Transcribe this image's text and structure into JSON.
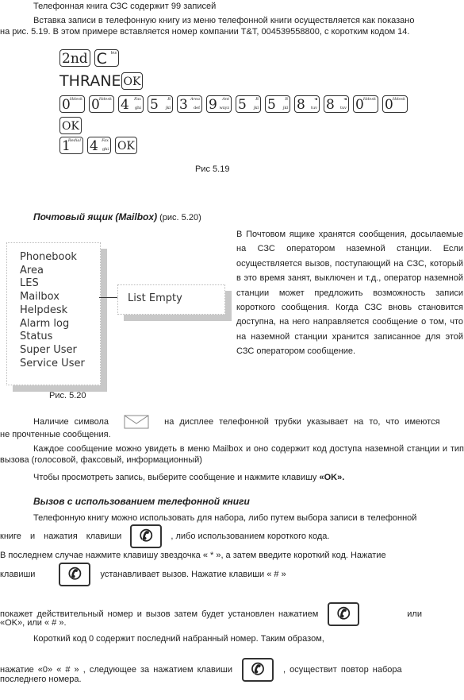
{
  "p1": "Телефонная книга СЗС содержит 99 записей",
  "p2a": "Вставка записи в телефонную книгу из меню телефонной книги осуществляется как показано",
  "p2b": "на рис. 5.19. В этом примере вставляется номер компании T&T, 004539558800, с коротким кодом 14.",
  "keys": {
    "k2nd": "2nd",
    "kC": "C",
    "kCsup": "Ins",
    "thrane": "THRANE",
    "ok": "OK",
    "digits": [
      {
        "d": "0",
        "sup": "Hdesk",
        "sub": ""
      },
      {
        "d": "0",
        "sup": "Hdesk",
        "sub": ""
      },
      {
        "d": "4",
        "sup": "Fax",
        "sub": "ghi"
      },
      {
        "d": "5",
        "sup": "R",
        "sub": "jkl"
      },
      {
        "d": "3",
        "sup": "Area",
        "sub": "def"
      },
      {
        "d": "9",
        "sup": "Ant",
        "sub": "wxyz"
      },
      {
        "d": "5",
        "sup": "R",
        "sub": "jkl"
      },
      {
        "d": "5",
        "sup": "R",
        "sub": "jkl"
      },
      {
        "d": "8",
        "sup": "◄",
        "sub": "tuv"
      },
      {
        "d": "8",
        "sup": "◄",
        "sub": "tuv"
      },
      {
        "d": "0",
        "sup": "Hdesk",
        "sub": ""
      },
      {
        "d": "0",
        "sup": "Hdesk",
        "sub": ""
      }
    ],
    "k1": "1",
    "k1sup": "Redial",
    "k4": "4",
    "k4sup": "Fax",
    "k4sub": "ghi"
  },
  "fig519": "Рис 5.19",
  "h1a": "Почтовый ящик (Mailbox)",
  "h1b": " (рис. 5.20)",
  "menu": [
    "Phonebook",
    "Area",
    "LES",
    "Mailbox",
    "Helpdesk",
    "Alarm log",
    "Status",
    "Super User",
    "Service User"
  ],
  "list_empty": "List Empty",
  "fig520": "Рис. 5.20",
  "side": "В Почтовом ящике хранятся сообщения, досылаемые на СЗС оператором наземной станции. Если осуществляется вызов, поступающий на СЗС, который в это время занят, выключен и т.д., оператор наземной станции может предложить возможность записи короткого сообщения. Когда СЗС вновь становится доступна, на него направляется сообщение о том, что на наземной станции хранится записанное для этой СЗС оператором сообщение.",
  "p3a": "Наличие символа",
  "p3b": "на дисплее телефонной трубки указывает на то, что имеются",
  "p3c": "не прочтенные сообщения.",
  "p4": "Каждое сообщение можно увидеть в меню Mailbox и оно содержит код доступа наземной станции и тип вызова (голосовой, факсовый, информационный)",
  "p5a": "Чтобы просмотреть запись, выберите сообщение и нажмите клавишу ",
  "p5b": "«OK».",
  "h2": "Вызов с использованием телефонной книги",
  "p6a": "Телефонную книгу можно использовать для набора, либо путем выбора записи в телефонной",
  "p6b": "книге и нажатия клавиши",
  "p6c": ", либо использованием короткого кода.",
  "p7a": "В последнем случае нажмите клавишу звездочка « * », а затем введите короткий код. Нажатие",
  "p7b": "клавиши",
  "p7c": "устанавливает вызов. Нажатие клавиши « # »",
  "p8a": "покажет действительный номер и вызов затем будет установлен нажатием",
  "p8b": "или",
  "p8c": "«OK»,  или « # ».",
  "p9": "Короткий код 0 содержит последний набранный номер. Таким образом,",
  "p10a": "нажатие «0» « # » , следующее за нажатием клавиши",
  "p10b": ", осуществит повтор набора",
  "p10c": "последнего номера."
}
